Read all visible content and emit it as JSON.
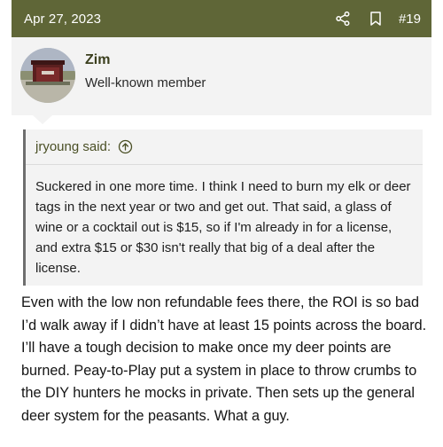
{
  "post": {
    "date": "Apr 27, 2023",
    "number": "#19",
    "icons": {
      "share": "share-icon",
      "bookmark": "bookmark-icon"
    },
    "colors": {
      "header_bg": "#5f6637",
      "user_strip_bg": "#f3f3f3",
      "quote_bar": "#6e6e6e"
    }
  },
  "user": {
    "name": "Zim",
    "title": "Well-known member"
  },
  "quote": {
    "author_label": "jryoung said:",
    "text": "Suckered in one more time. I think I need to burn my elk or deer tags in the next year or two and get out. That said, a glass of wine or a cocktail out is $15, so if I'm already in for a license, and extra $15 or $30 isn't really that big of a deal after the license."
  },
  "body": {
    "text": "Even with the low non refundable fees there, the ROI is so bad I’d walk away if I didn’t have at least 15 points across the board. I’ll have a tough decision to make once my deer points are burned. Peay-to-Play put a system in place to throw crumbs to the DIY hunters he mocks in private. Then sets up the general deer system for the peasants. What a guy."
  }
}
